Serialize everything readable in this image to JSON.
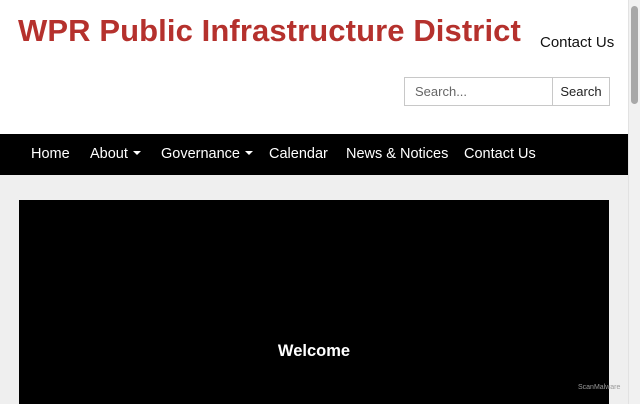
{
  "header": {
    "site_title": "WPR Public Infrastructure District",
    "top_link": "Contact Us",
    "search_placeholder": "Search...",
    "search_button": "Search"
  },
  "nav": {
    "items": [
      {
        "label": "Home",
        "dropdown": false
      },
      {
        "label": "About",
        "dropdown": true
      },
      {
        "label": "Governance",
        "dropdown": true
      },
      {
        "label": "Calendar",
        "dropdown": false
      },
      {
        "label": "News & Notices",
        "dropdown": false
      },
      {
        "label": "Contact Us",
        "dropdown": false
      }
    ]
  },
  "hero": {
    "title": "Welcome"
  },
  "watermark": "ScanMalware",
  "colors": {
    "brand": "#b5312d",
    "nav_bg": "#000000",
    "hero_bg": "#000000",
    "page_bg": "#efefef"
  }
}
